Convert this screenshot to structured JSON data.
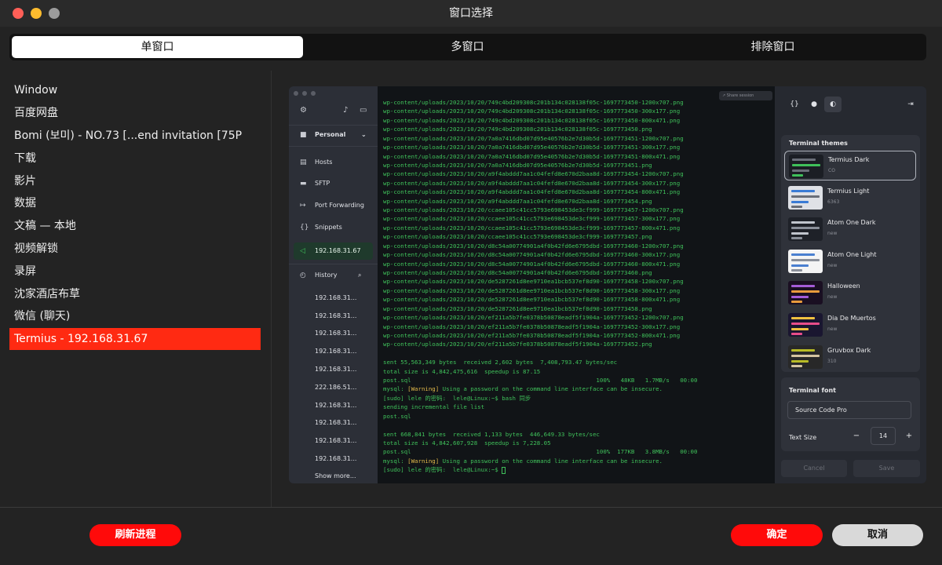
{
  "window": {
    "title": "窗口选择"
  },
  "tabs": [
    {
      "label": "单窗口",
      "active": true
    },
    {
      "label": "多窗口",
      "active": false
    },
    {
      "label": "排除窗口",
      "active": false
    }
  ],
  "window_list": [
    {
      "label": "Window",
      "selected": false
    },
    {
      "label": "百度网盘",
      "selected": false
    },
    {
      "label": "Bomi (보미) - NO.73 [...end invitation [75P",
      "selected": false
    },
    {
      "label": "下载",
      "selected": false
    },
    {
      "label": "影片",
      "selected": false
    },
    {
      "label": "数据",
      "selected": false
    },
    {
      "label": "文稿 — 本地",
      "selected": false
    },
    {
      "label": "视频解锁",
      "selected": false
    },
    {
      "label": "录屏",
      "selected": false
    },
    {
      "label": "沈家酒店布草",
      "selected": false
    },
    {
      "label": "微信 (聊天)",
      "selected": false
    },
    {
      "label": "Termius - 192.168.31.67",
      "selected": true
    }
  ],
  "termius": {
    "sidebar": {
      "vault": "Personal",
      "nav": [
        {
          "icon": "hosts-icon",
          "glyph": "▤",
          "label": "Hosts"
        },
        {
          "icon": "sftp-icon",
          "glyph": "▬",
          "label": "SFTP"
        },
        {
          "icon": "port-forwarding-icon",
          "glyph": "↦",
          "label": "Port Forwarding"
        },
        {
          "icon": "snippets-icon",
          "glyph": "{}",
          "label": "Snippets"
        }
      ],
      "active_host": "192.168.31.67",
      "history_label": "History",
      "history": [
        "192.168.31...",
        "192.168.31...",
        "192.168.31...",
        "192.168.31...",
        "192.168.31...",
        "222.186.51...",
        "192.168.31...",
        "192.168.31...",
        "192.168.31...",
        "192.168.31..."
      ],
      "show_more": "Show more..."
    },
    "share_label": "Share session",
    "terminal_lines": [
      {
        "text": "wp-content/uploads/2023/10/20/749c4bd209308c201b134c028138f05c-1697773450-1200x707.png"
      },
      {
        "text": "wp-content/uploads/2023/10/20/749c4bd209308c201b134c028138f05c-1697773450-300x177.png"
      },
      {
        "text": "wp-content/uploads/2023/10/20/749c4bd209308c201b134c028138f05c-1697773450-800x471.png"
      },
      {
        "text": "wp-content/uploads/2023/10/20/749c4bd209308c201b134c028138f05c-1697773450.png"
      },
      {
        "text": "wp-content/uploads/2023/10/20/7a0a7416dbd07d95e40576b2e7d30b5d-1697773451-1200x707.png"
      },
      {
        "text": "wp-content/uploads/2023/10/20/7a0a7416dbd07d95e40576b2e7d30b5d-1697773451-300x177.png"
      },
      {
        "text": "wp-content/uploads/2023/10/20/7a0a7416dbd07d95e40576b2e7d30b5d-1697773451-800x471.png"
      },
      {
        "text": "wp-content/uploads/2023/10/20/7a0a7416dbd07d95e40576b2e7d30b5d-1697773451.png"
      },
      {
        "text": "wp-content/uploads/2023/10/20/a9f4abddd7aa1c04fefd8e670d2baa8d-1697773454-1200x707.png"
      },
      {
        "text": "wp-content/uploads/2023/10/20/a9f4abddd7aa1c04fefd8e670d2baa8d-1697773454-300x177.png"
      },
      {
        "text": "wp-content/uploads/2023/10/20/a9f4abddd7aa1c04fefd8e670d2baa8d-1697773454-800x471.png"
      },
      {
        "text": "wp-content/uploads/2023/10/20/a9f4abddd7aa1c04fefd8e670d2baa8d-1697773454.png"
      },
      {
        "text": "wp-content/uploads/2023/10/20/ccaee105c41cc5793e698453de3cf999-1697773457-1200x707.png"
      },
      {
        "text": "wp-content/uploads/2023/10/20/ccaee105c41cc5793e698453de3cf999-1697773457-300x177.png"
      },
      {
        "text": "wp-content/uploads/2023/10/20/ccaee105c41cc5793e698453de3cf999-1697773457-800x471.png"
      },
      {
        "text": "wp-content/uploads/2023/10/20/ccaee105c41cc5793e698453de3cf999-1697773457.png"
      },
      {
        "text": "wp-content/uploads/2023/10/20/d8c54a00774901a4f0b42fd6e6795dbd-1697773460-1200x707.png"
      },
      {
        "text": "wp-content/uploads/2023/10/20/d8c54a00774901a4f0b42fd6e6795dbd-1697773460-300x177.png"
      },
      {
        "text": "wp-content/uploads/2023/10/20/d8c54a00774901a4f0b42fd6e6795dbd-1697773460-800x471.png"
      },
      {
        "text": "wp-content/uploads/2023/10/20/d8c54a00774901a4f0b42fd6e6795dbd-1697773460.png"
      },
      {
        "text": "wp-content/uploads/2023/10/20/de5287261d8ee9710ea1bcb537ef8d90-1697773458-1200x707.png"
      },
      {
        "text": "wp-content/uploads/2023/10/20/de5287261d8ee9710ea1bcb537ef8d90-1697773458-300x177.png"
      },
      {
        "text": "wp-content/uploads/2023/10/20/de5287261d8ee9710ea1bcb537ef8d90-1697773458-800x471.png"
      },
      {
        "text": "wp-content/uploads/2023/10/20/de5287261d8ee9710ea1bcb537ef8d90-1697773458.png"
      },
      {
        "text": "wp-content/uploads/2023/10/20/ef211a5b7fe0378b50878eadf5f1904a-1697773452-1200x707.png"
      },
      {
        "text": "wp-content/uploads/2023/10/20/ef211a5b7fe0378b50878eadf5f1904a-1697773452-300x177.png"
      },
      {
        "text": "wp-content/uploads/2023/10/20/ef211a5b7fe0378b50878eadf5f1904a-1697773452-800x471.png"
      },
      {
        "text": "wp-content/uploads/2023/10/20/ef211a5b7fe0378b50878eadf5f1904a-1697773452.png"
      },
      {
        "text": ""
      },
      {
        "text": "sent 55,563,349 bytes  received 2,602 bytes  7,408,793.47 bytes/sec"
      },
      {
        "text": "total size is 4,842,475,616  speedup is 87.15"
      },
      {
        "text": "post.sql                                                     100%   48KB   1.7MB/s   00:00"
      },
      {
        "pre": "mysql: ",
        "warn": "[Warning]",
        "post": " Using a password on the command line interface can be insecure."
      },
      {
        "text": "[sudo] lele 的密码:  lele@Linux:~$ bash 同步"
      },
      {
        "text": "sending incremental file list"
      },
      {
        "text": "post.sql"
      },
      {
        "text": ""
      },
      {
        "text": "sent 668,841 bytes  received 1,133 bytes  446,649.33 bytes/sec"
      },
      {
        "text": "total size is 4,842,607,928  speedup is 7,228.05"
      },
      {
        "text": "post.sql                                                     100%  177KB   3.8MB/s   00:00"
      },
      {
        "pre": "mysql: ",
        "warn": "[Warning]",
        "post": " Using a password on the command line interface can be insecure."
      },
      {
        "text": "[sudo] lele 的密码:  lele@Linux:~$ ",
        "cursor": true
      }
    ],
    "themes_panel": {
      "title": "Terminal themes",
      "themes": [
        {
          "name": "Termius Dark",
          "sub": "CO",
          "selected": true,
          "thumb_bg": "#1b1e24",
          "bar": "#3fc05a",
          "bar2": "#6a6e78"
        },
        {
          "name": "Termius Light",
          "sub": "6363",
          "selected": false,
          "thumb_bg": "#dfe1e6",
          "bar": "#6a6e78",
          "bar2": "#3a7bd5"
        },
        {
          "name": "Atom One Dark",
          "sub": "new",
          "selected": false,
          "thumb_bg": "#1e2128",
          "bar": "#8a8f99",
          "bar2": "#c0c4cc"
        },
        {
          "name": "Atom One Light",
          "sub": "new",
          "selected": false,
          "thumb_bg": "#f4f4f4",
          "bar": "#8a8f99",
          "bar2": "#4a7fd0"
        },
        {
          "name": "Halloween",
          "sub": "new",
          "selected": false,
          "thumb_bg": "#1a0f22",
          "bar": "#e89a3c",
          "bar2": "#a45cd8"
        },
        {
          "name": "Dia De Muertos",
          "sub": "new",
          "selected": false,
          "thumb_bg": "#1a1630",
          "bar": "#e84d8a",
          "bar2": "#f0c040"
        },
        {
          "name": "Gruvbox Dark",
          "sub": "310",
          "selected": false,
          "thumb_bg": "#282828",
          "bar": "#d5c4a1",
          "bar2": "#b8bb26"
        }
      ]
    },
    "font_panel": {
      "title": "Terminal font",
      "font": "Source Code Pro",
      "text_size_label": "Text Size",
      "minus": "−",
      "plus": "+",
      "size": "14"
    },
    "cancel_label": "Cancel",
    "save_label": "Save"
  },
  "buttons": {
    "refresh": "刷新进程",
    "confirm": "确定",
    "cancel": "取消"
  },
  "colors": {
    "accent": "#ff2a12",
    "button_red": "#ff0a0a"
  }
}
